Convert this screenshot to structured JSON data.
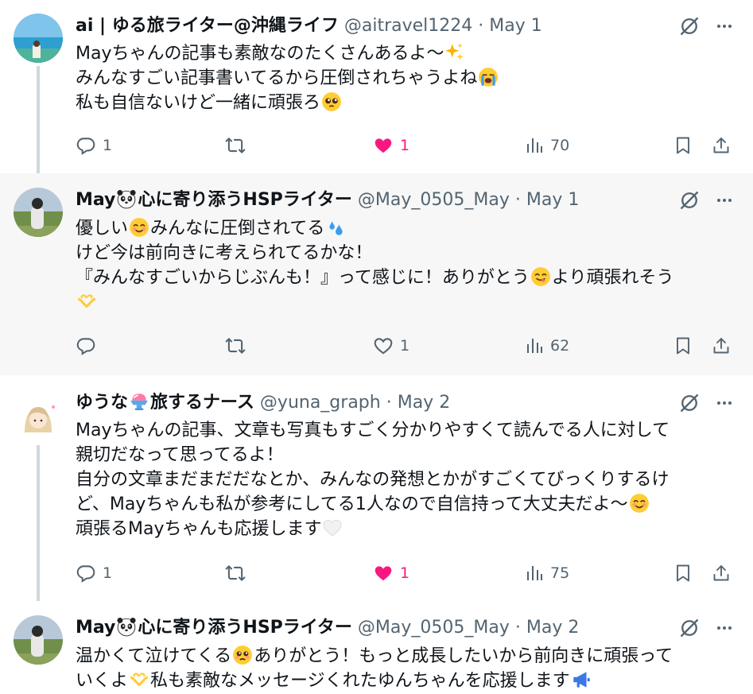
{
  "tweets": [
    {
      "name": "ai | ゆる旅ライター@沖縄ライフ",
      "handle": "@aitravel1224",
      "sep": "·",
      "date": "May 1",
      "lines": [
        "Mayちゃんの記事も素敵なのたくさんあるよ〜",
        "みんなすごい記事書いてるから圧倒されちゃうよね",
        "私も自信ないけど一緒に頑張ろ"
      ],
      "replies": "1",
      "retweets": "",
      "likes": "1",
      "views": "70",
      "liked": true
    },
    {
      "name": "May",
      "name_rest": "心に寄り添うHSPライター",
      "handle": "@May_0505_May",
      "sep": "·",
      "date": "May 1",
      "lines": [
        "優しい",
        "みんなに圧倒されてる",
        "けど今は前向きに考えられてるかな！",
        "『みんなすごいからじぶんも！』って感じに！ありがとう",
        "より頑張れそう"
      ],
      "replies": "",
      "retweets": "",
      "likes": "1",
      "views": "62",
      "liked": false
    },
    {
      "name": "ゆうな",
      "name_rest": "旅するナース",
      "handle": "@yuna_graph",
      "sep": "·",
      "date": "May 2",
      "lines": [
        "Mayちゃんの記事、文章も写真もすごく分かりやすくて読んでる人に対して",
        "親切だなって思ってるよ！",
        "自分の文章まだまだだなとか、みんなの発想とかがすごくてびっくりするけ",
        "ど、Mayちゃんも私が参考にしてる1人なので自信持って大丈夫だよ〜",
        "頑張るMayちゃんも応援します"
      ],
      "replies": "1",
      "retweets": "",
      "likes": "1",
      "views": "75",
      "liked": true
    },
    {
      "name": "May",
      "name_rest": "心に寄り添うHSPライター",
      "handle": "@May_0505_May",
      "sep": "·",
      "date": "May 2",
      "lines": [
        "温かくて泣けてくる",
        "ありがとう！もっと成長したいから前向きに頑張って",
        "いくよ",
        "私も素敵なメッセージくれたゆんちゃんを応援します"
      ]
    }
  ],
  "colors": {
    "like": "#f91880",
    "icon": "#536471",
    "text": "#0f1419",
    "highlight": "#f7f7f7",
    "thread": "#cfd9de"
  }
}
